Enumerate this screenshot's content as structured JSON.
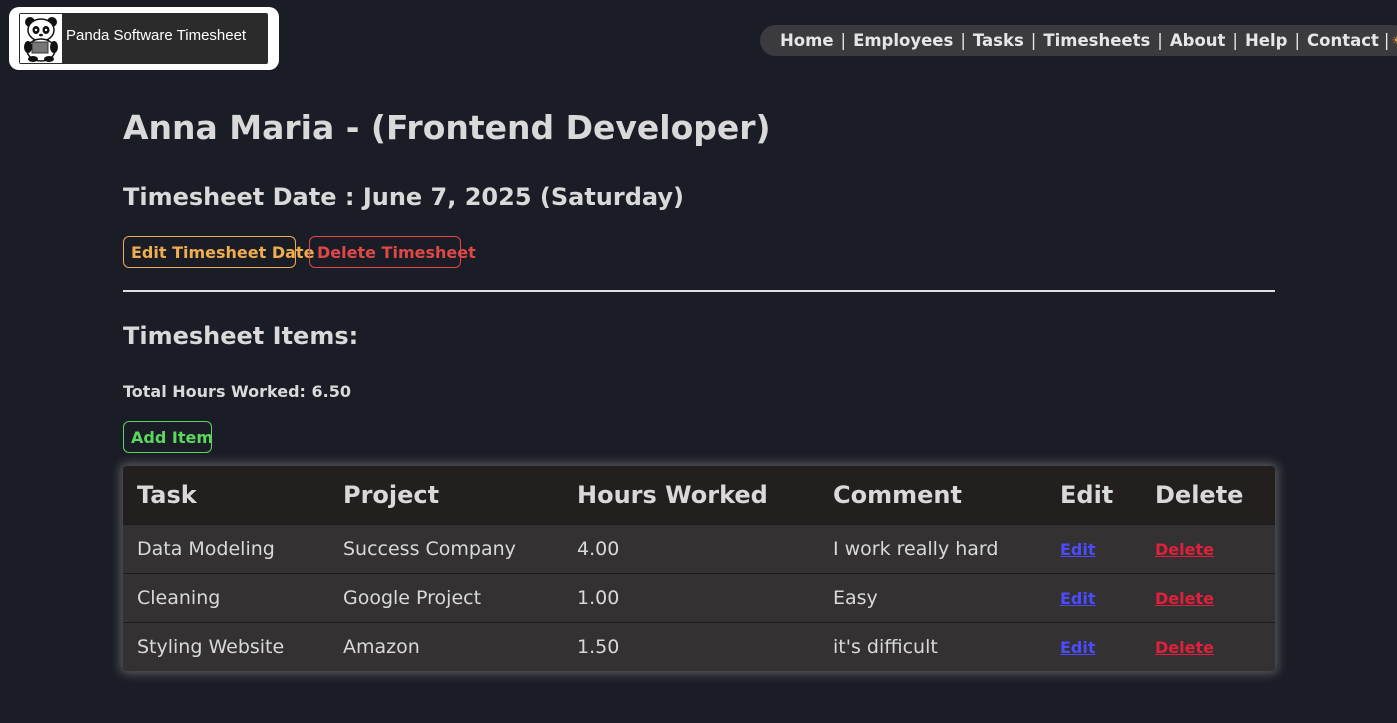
{
  "app": {
    "logo_text": "Panda Software Timesheet",
    "logo_icon": "panda-icon"
  },
  "nav": {
    "items": [
      {
        "label": "Home"
      },
      {
        "label": "Employees"
      },
      {
        "label": "Tasks"
      },
      {
        "label": "Timesheets"
      },
      {
        "label": "About"
      },
      {
        "label": "Help"
      },
      {
        "label": "Contact"
      }
    ],
    "separator": "|",
    "theme_toggle": {
      "sun_icon": "sun-icon",
      "moon_icon": "moon-icon",
      "state": "dark"
    }
  },
  "employee": {
    "heading": "Anna Maria - (Frontend Developer)"
  },
  "timesheet": {
    "date_heading": "Timesheet Date : June 7, 2025 (Saturday)",
    "edit_label": "Edit Timesheet Date",
    "delete_label": "Delete Timesheet",
    "items_heading": "Timesheet Items:",
    "total_label": "Total Hours Worked:",
    "total_value": "6.50",
    "add_label": "Add Item"
  },
  "table": {
    "headers": [
      "Task",
      "Project",
      "Hours Worked",
      "Comment",
      "Edit",
      "Delete"
    ],
    "rows": [
      {
        "task": "Data Modeling",
        "project": "Success Company",
        "hours": "4.00",
        "comment": "I work really hard",
        "edit": "Edit",
        "delete": "Delete"
      },
      {
        "task": "Cleaning",
        "project": "Google Project",
        "hours": "1.00",
        "comment": "Easy",
        "edit": "Edit",
        "delete": "Delete"
      },
      {
        "task": "Styling Website",
        "project": "Amazon",
        "hours": "1.50",
        "comment": "it's difficult",
        "edit": "Edit",
        "delete": "Delete"
      }
    ]
  },
  "colors": {
    "background": "#1b1d26",
    "edit_accent": "#f0ad4e",
    "delete_accent": "#e04848",
    "add_accent": "#5cd65c",
    "link_edit": "#4b4bff",
    "link_delete": "#e0203c"
  }
}
